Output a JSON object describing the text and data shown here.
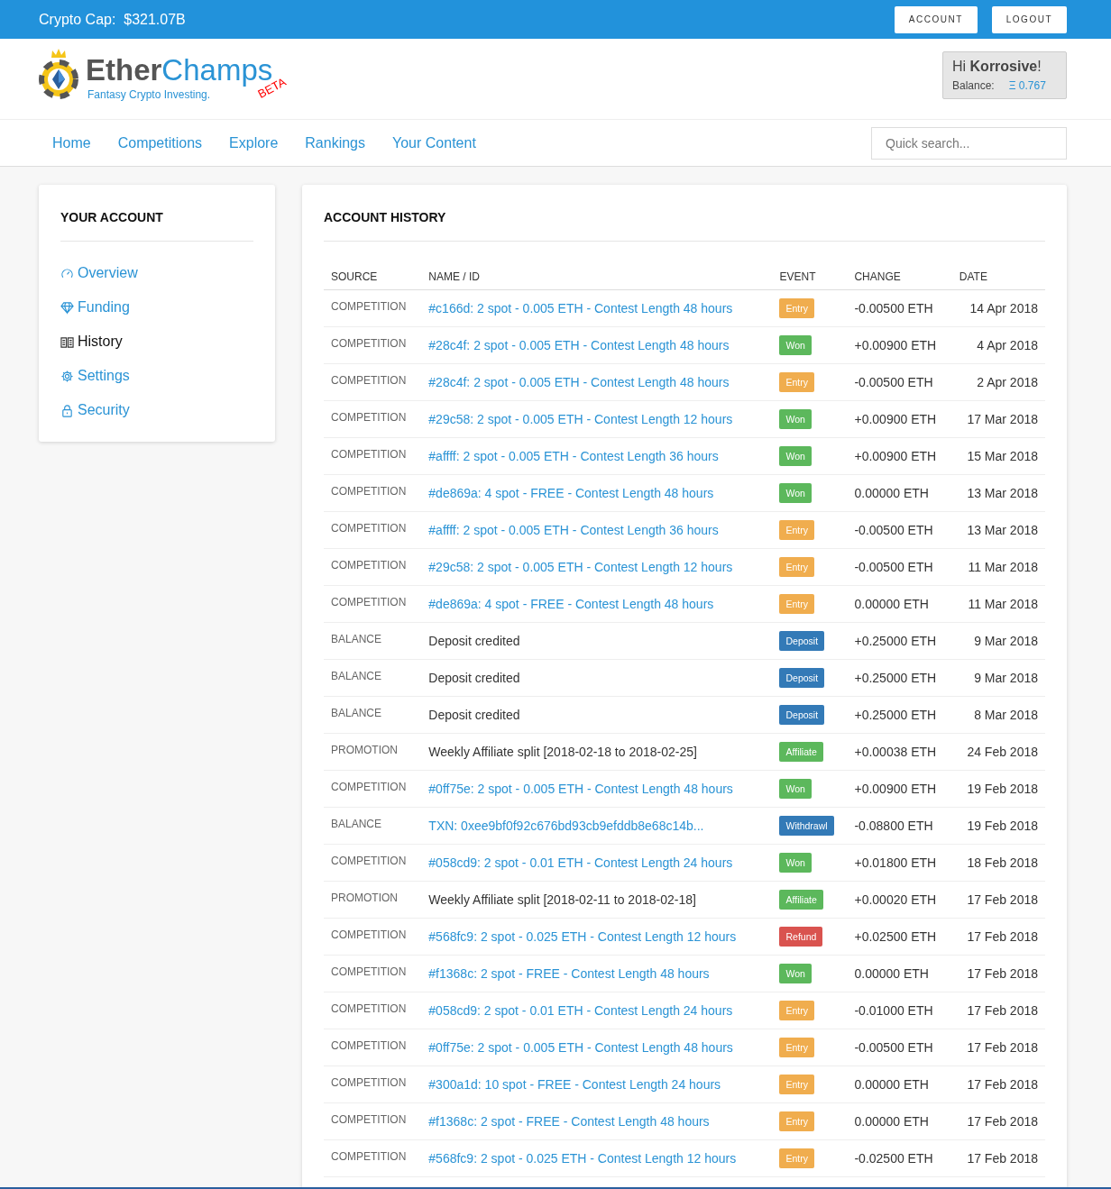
{
  "top_bar": {
    "label": "Crypto Cap:",
    "value": "$321.07B",
    "buttons": [
      "ACCOUNT",
      "LOGOUT"
    ]
  },
  "logo": {
    "name_dark": "Ether",
    "name_light": "Champs",
    "badge": "BETA",
    "tagline": "Fantasy Crypto Investing."
  },
  "user_box": {
    "greeting": "Hi **Korrosive**!",
    "balance_label": "Balance:",
    "balance_value": "Ξ 0.767"
  },
  "nav": {
    "items": [
      "Home",
      "Competitions",
      "Explore",
      "Rankings",
      "Your Content"
    ],
    "search_placeholder": "Quick search..."
  },
  "sidebar": {
    "title": "YOUR ACCOUNT",
    "items": [
      {
        "label": "Overview",
        "kind": "gauge",
        "selected": false
      },
      {
        "label": "Funding",
        "kind": "gem",
        "selected": false
      },
      {
        "label": "History",
        "kind": "book",
        "selected": true
      },
      {
        "label": "Settings",
        "kind": "gear",
        "selected": false
      },
      {
        "label": "Security",
        "kind": "lock",
        "selected": false
      }
    ]
  },
  "history": {
    "title": "ACCOUNT HISTORY",
    "columns": [
      "SOURCE",
      "NAME / ID",
      "EVENT",
      "CHANGE",
      "DATE"
    ],
    "rows": [
      {
        "source": "COMPETITION",
        "name": "#c166d: 2 spot - 0.005 ETH - Contest Length 48 hours",
        "linked": true,
        "event": "Entry",
        "kind": "entry",
        "change": "-0.00500 ETH",
        "date": "14 Apr 2018"
      },
      {
        "source": "COMPETITION",
        "name": "#28c4f: 2 spot - 0.005 ETH - Contest Length 48 hours",
        "linked": true,
        "event": "Won",
        "kind": "won",
        "change": "+0.00900 ETH",
        "date": "4 Apr 2018"
      },
      {
        "source": "COMPETITION",
        "name": "#28c4f: 2 spot - 0.005 ETH - Contest Length 48 hours",
        "linked": true,
        "event": "Entry",
        "kind": "entry",
        "change": "-0.00500 ETH",
        "date": "2 Apr 2018"
      },
      {
        "source": "COMPETITION",
        "name": "#29c58: 2 spot - 0.005 ETH - Contest Length 12 hours",
        "linked": true,
        "event": "Won",
        "kind": "won",
        "change": "+0.00900 ETH",
        "date": "17 Mar 2018"
      },
      {
        "source": "COMPETITION",
        "name": "#affff: 2 spot - 0.005 ETH - Contest Length 36 hours",
        "linked": true,
        "event": "Won",
        "kind": "won",
        "change": "+0.00900 ETH",
        "date": "15 Mar 2018"
      },
      {
        "source": "COMPETITION",
        "name": "#de869a: 4 spot - FREE - Contest Length 48 hours",
        "linked": true,
        "event": "Won",
        "kind": "won",
        "change": "0.00000 ETH",
        "date": "13 Mar 2018"
      },
      {
        "source": "COMPETITION",
        "name": "#affff: 2 spot - 0.005 ETH - Contest Length 36 hours",
        "linked": true,
        "event": "Entry",
        "kind": "entry",
        "change": "-0.00500 ETH",
        "date": "13 Mar 2018"
      },
      {
        "source": "COMPETITION",
        "name": "#29c58: 2 spot - 0.005 ETH - Contest Length 12 hours",
        "linked": true,
        "event": "Entry",
        "kind": "entry",
        "change": "-0.00500 ETH",
        "date": "11 Mar 2018"
      },
      {
        "source": "COMPETITION",
        "name": "#de869a: 4 spot - FREE - Contest Length 48 hours",
        "linked": true,
        "event": "Entry",
        "kind": "entry",
        "change": "0.00000 ETH",
        "date": "11 Mar 2018"
      },
      {
        "source": "BALANCE",
        "name": "Deposit credited",
        "linked": false,
        "event": "Deposit",
        "kind": "deposit",
        "change": "+0.25000 ETH",
        "date": "9 Mar 2018"
      },
      {
        "source": "BALANCE",
        "name": "Deposit credited",
        "linked": false,
        "event": "Deposit",
        "kind": "deposit",
        "change": "+0.25000 ETH",
        "date": "9 Mar 2018"
      },
      {
        "source": "BALANCE",
        "name": "Deposit credited",
        "linked": false,
        "event": "Deposit",
        "kind": "deposit",
        "change": "+0.25000 ETH",
        "date": "8 Mar 2018"
      },
      {
        "source": "PROMOTION",
        "name": "Weekly Affiliate split [2018-02-18 to 2018-02-25]",
        "linked": false,
        "event": "Affiliate",
        "kind": "affiliate",
        "change": "+0.00038 ETH",
        "date": "24 Feb 2018"
      },
      {
        "source": "COMPETITION",
        "name": "#0ff75e: 2 spot - 0.005 ETH - Contest Length 48 hours",
        "linked": true,
        "event": "Won",
        "kind": "won",
        "change": "+0.00900 ETH",
        "date": "19 Feb 2018"
      },
      {
        "source": "BALANCE",
        "name": "TXN: 0xee9bf0f92c676bd93cb9efddb8e68c14b...",
        "linked": true,
        "event": "Withdrawl",
        "kind": "withdrawal",
        "change": "-0.08800 ETH",
        "date": "19 Feb 2018"
      },
      {
        "source": "COMPETITION",
        "name": "#058cd9: 2 spot - 0.01 ETH - Contest Length 24 hours",
        "linked": true,
        "event": "Won",
        "kind": "won",
        "change": "+0.01800 ETH",
        "date": "18 Feb 2018"
      },
      {
        "source": "PROMOTION",
        "name": "Weekly Affiliate split [2018-02-11 to 2018-02-18]",
        "linked": false,
        "event": "Affiliate",
        "kind": "affiliate",
        "change": "+0.00020 ETH",
        "date": "17 Feb 2018"
      },
      {
        "source": "COMPETITION",
        "name": "#568fc9: 2 spot - 0.025 ETH - Contest Length 12 hours",
        "linked": true,
        "event": "Refund",
        "kind": "refund",
        "change": "+0.02500 ETH",
        "date": "17 Feb 2018"
      },
      {
        "source": "COMPETITION",
        "name": "#f1368c: 2 spot - FREE - Contest Length 48 hours",
        "linked": true,
        "event": "Won",
        "kind": "won",
        "change": "0.00000 ETH",
        "date": "17 Feb 2018"
      },
      {
        "source": "COMPETITION",
        "name": "#058cd9: 2 spot - 0.01 ETH - Contest Length 24 hours",
        "linked": true,
        "event": "Entry",
        "kind": "entry",
        "change": "-0.01000 ETH",
        "date": "17 Feb 2018"
      },
      {
        "source": "COMPETITION",
        "name": "#0ff75e: 2 spot - 0.005 ETH - Contest Length 48 hours",
        "linked": true,
        "event": "Entry",
        "kind": "entry",
        "change": "-0.00500 ETH",
        "date": "17 Feb 2018"
      },
      {
        "source": "COMPETITION",
        "name": "#300a1d: 10 spot - FREE - Contest Length 24 hours",
        "linked": true,
        "event": "Entry",
        "kind": "entry",
        "change": "0.00000 ETH",
        "date": "17 Feb 2018"
      },
      {
        "source": "COMPETITION",
        "name": "#f1368c: 2 spot - FREE - Contest Length 48 hours",
        "linked": true,
        "event": "Entry",
        "kind": "entry",
        "change": "0.00000 ETH",
        "date": "17 Feb 2018"
      },
      {
        "source": "COMPETITION",
        "name": "#568fc9: 2 spot - 0.025 ETH - Contest Length 12 hours",
        "linked": true,
        "event": "Entry",
        "kind": "entry",
        "change": "-0.02500 ETH",
        "date": "17 Feb 2018"
      }
    ]
  }
}
